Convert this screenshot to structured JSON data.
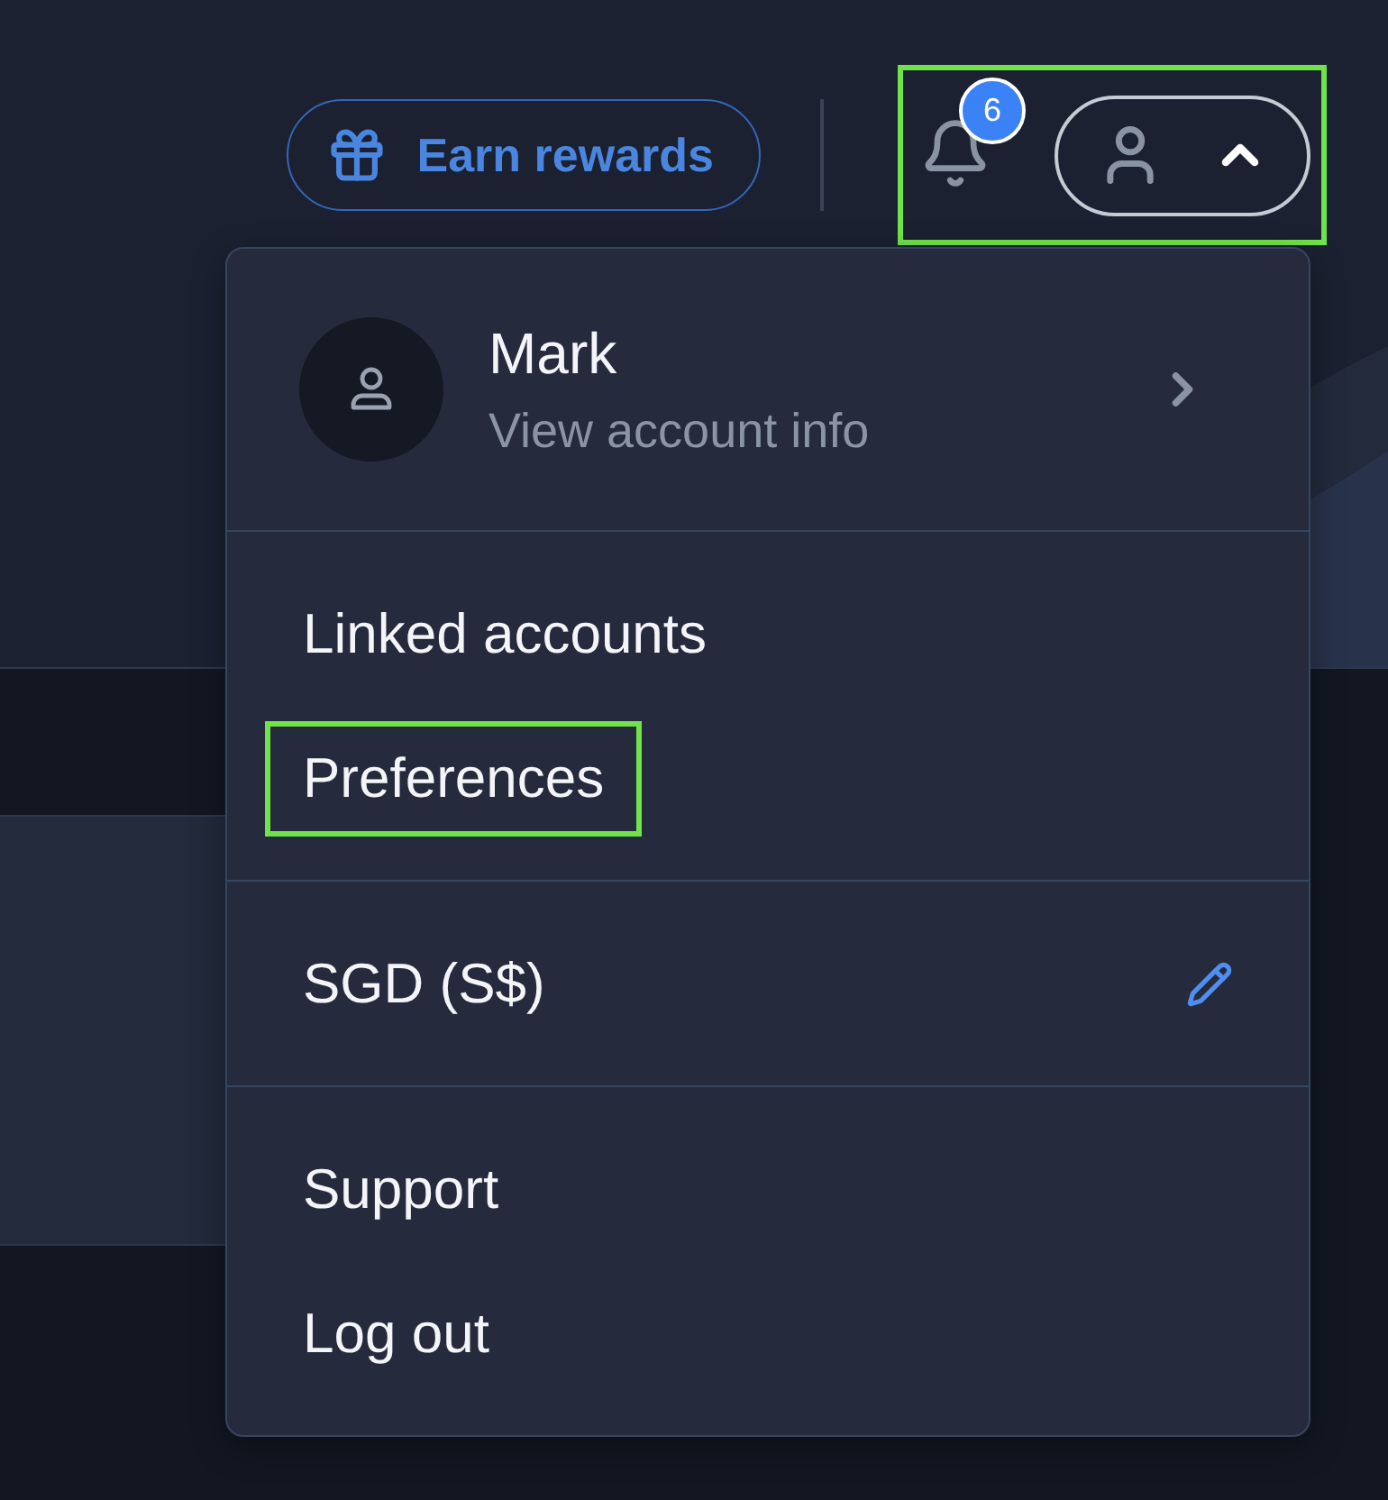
{
  "header": {
    "rewards_button": {
      "label": "Earn rewards"
    },
    "notifications": {
      "count": "6"
    },
    "account": {
      "expanded": true,
      "highlighted": true
    }
  },
  "menu": {
    "profile": {
      "name": "Mark",
      "subtitle": "View account info"
    },
    "sections": [
      {
        "items": [
          {
            "kind": "link",
            "label": "Linked accounts",
            "highlighted": false
          },
          {
            "kind": "link",
            "label": "Preferences",
            "highlighted": true
          }
        ]
      },
      {
        "items": [
          {
            "kind": "editable",
            "label": "SGD (S$)"
          }
        ]
      },
      {
        "items": [
          {
            "kind": "link",
            "label": "Support",
            "highlighted": false
          },
          {
            "kind": "link",
            "label": "Log out",
            "highlighted": false
          }
        ]
      }
    ]
  }
}
